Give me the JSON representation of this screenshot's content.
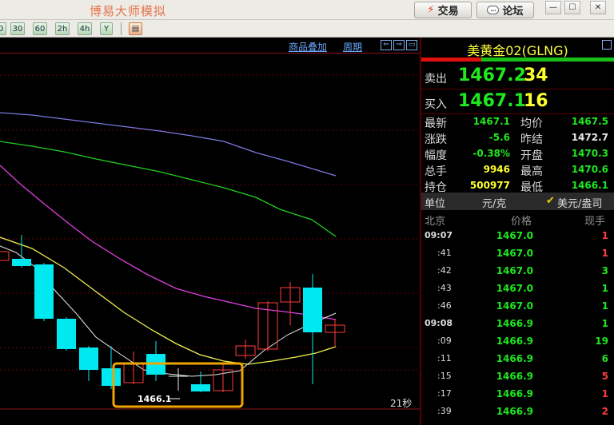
{
  "titlebar": {
    "title": "博易大师模拟",
    "trade_label": "交易",
    "forum_label": "论坛",
    "forum_icon_text": "…",
    "win_controls": [
      "—",
      "☐",
      "✕"
    ]
  },
  "toolbar": {
    "periods": [
      "0",
      "30",
      "60",
      "2h",
      "4h",
      "Y"
    ]
  },
  "chart_header": {
    "overlay_link": "商品叠加",
    "period_link": "周期",
    "nav_buttons": [
      "⇐",
      "⇒",
      "▭"
    ]
  },
  "chart": {
    "low_label": "1466.1",
    "countdown": "21秒",
    "colors": {
      "up": "#ff3c3c",
      "down": "#00e8f0",
      "ma5": "#e8e8e8",
      "ma10": "#f0f050",
      "ma20": "#e040e0",
      "ma40": "#20d020",
      "ma60": "#7a7ae0",
      "highlight": "#f0a400"
    }
  },
  "quote": {
    "title": "美黄金02(GLNG)",
    "sell_label": "卖出",
    "sell_price": "1467.2",
    "sell_volume": "34",
    "buy_label": "买入",
    "buy_price": "1467.1",
    "buy_volume": "16",
    "stats_left": [
      {
        "label": "最新",
        "value": "1467.1",
        "color": "#1fe81f"
      },
      {
        "label": "涨跌",
        "value": "-5.6",
        "color": "#1fe81f"
      },
      {
        "label": "幅度",
        "value": "-0.38%",
        "color": "#1fe81f"
      },
      {
        "label": "总手",
        "value": "9946",
        "color": "#ffff30"
      },
      {
        "label": "持仓",
        "value": "500977",
        "color": "#ffff30"
      }
    ],
    "stats_right": [
      {
        "label": "均价",
        "value": "1467.5",
        "color": "#1fe81f"
      },
      {
        "label": "昨结",
        "value": "1472.7",
        "color": "#e8e8e8"
      },
      {
        "label": "开盘",
        "value": "1470.3",
        "color": "#1fe81f"
      },
      {
        "label": "最高",
        "value": "1470.6",
        "color": "#1fe81f"
      },
      {
        "label": "最低",
        "value": "1466.1",
        "color": "#1fe81f"
      }
    ],
    "unit_label": "单位",
    "unit_value": "元/克",
    "unit_alt": "美元/盎司",
    "tick_headers": [
      "北京",
      "价格",
      "现手"
    ],
    "ticks": [
      {
        "time": "09:07",
        "price": "1467.0",
        "vol": "1",
        "vcolor": "#ff3c3c",
        "major": true
      },
      {
        "time": ":41",
        "price": "1467.0",
        "vol": "1",
        "vcolor": "#ff3c3c",
        "major": false
      },
      {
        "time": ":42",
        "price": "1467.0",
        "vol": "3",
        "vcolor": "#1fe81f",
        "major": false
      },
      {
        "time": ":43",
        "price": "1467.0",
        "vol": "1",
        "vcolor": "#1fe81f",
        "major": false
      },
      {
        "time": ":46",
        "price": "1467.0",
        "vol": "1",
        "vcolor": "#1fe81f",
        "major": false
      },
      {
        "time": "09:08",
        "price": "1466.9",
        "vol": "1",
        "vcolor": "#1fe81f",
        "major": true
      },
      {
        "time": ":09",
        "price": "1466.9",
        "vol": "19",
        "vcolor": "#1fe81f",
        "major": false
      },
      {
        "time": ":11",
        "price": "1466.9",
        "vol": "6",
        "vcolor": "#1fe81f",
        "major": false
      },
      {
        "time": ":15",
        "price": "1466.9",
        "vol": "5",
        "vcolor": "#ff3c3c",
        "major": false
      },
      {
        "time": ":17",
        "price": "1466.9",
        "vol": "1",
        "vcolor": "#ff3c3c",
        "major": false
      },
      {
        "time": ":39",
        "price": "1466.9",
        "vol": "2",
        "vcolor": "#ff3c3c",
        "major": false
      }
    ]
  }
}
